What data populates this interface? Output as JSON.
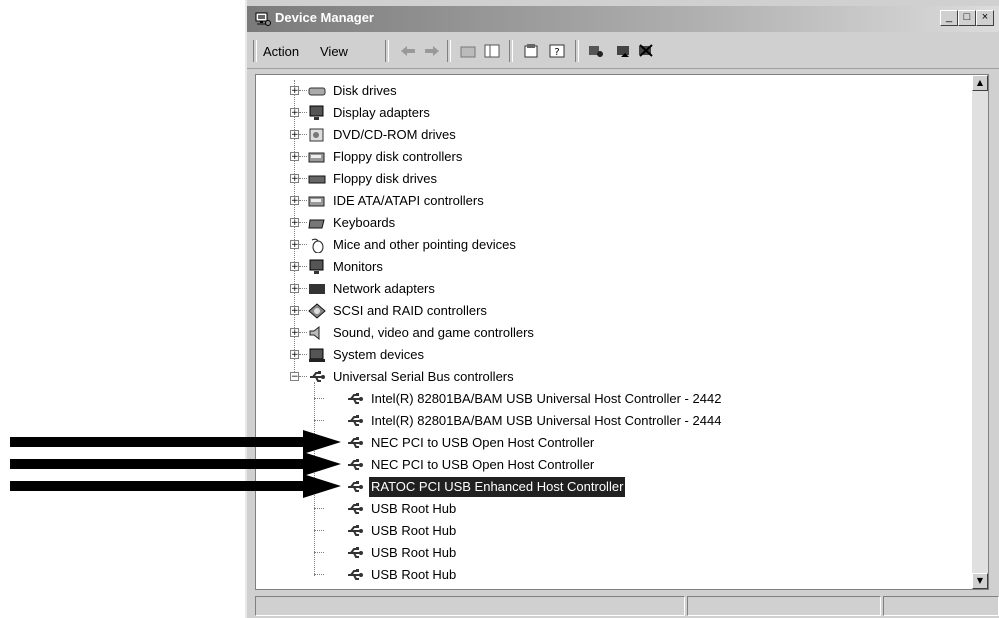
{
  "window": {
    "title": "Device Manager"
  },
  "toolbar": {
    "menu": [
      "Action",
      "View"
    ]
  },
  "tree": {
    "categories": [
      {
        "label": "Disk drives",
        "icon": "disk-drive-icon"
      },
      {
        "label": "Display adapters",
        "icon": "monitor-icon"
      },
      {
        "label": "DVD/CD-ROM drives",
        "icon": "cdrom-icon"
      },
      {
        "label": "Floppy disk controllers",
        "icon": "controller-icon"
      },
      {
        "label": "Floppy disk drives",
        "icon": "floppy-drive-icon"
      },
      {
        "label": "IDE ATA/ATAPI controllers",
        "icon": "controller-icon"
      },
      {
        "label": "Keyboards",
        "icon": "keyboard-icon"
      },
      {
        "label": "Mice and other pointing devices",
        "icon": "mouse-icon"
      },
      {
        "label": "Monitors",
        "icon": "monitor-icon"
      },
      {
        "label": "Network adapters",
        "icon": "network-adapter-icon"
      },
      {
        "label": "SCSI and RAID controllers",
        "icon": "scsi-icon"
      },
      {
        "label": "Sound, video and game controllers",
        "icon": "sound-icon"
      },
      {
        "label": "System devices",
        "icon": "system-icon"
      },
      {
        "label": "Universal Serial Bus controllers",
        "icon": "usb-icon",
        "expanded": true
      }
    ],
    "usb_children": [
      {
        "label": "Intel(R) 82801BA/BAM USB Universal Host Controller - 2442"
      },
      {
        "label": "Intel(R) 82801BA/BAM USB Universal Host Controller - 2444"
      },
      {
        "label": "NEC PCI to USB Open Host Controller"
      },
      {
        "label": "NEC PCI to USB Open Host Controller"
      },
      {
        "label": "RATOC PCI USB Enhanced Host Controller",
        "selected": true
      },
      {
        "label": "USB Root Hub"
      },
      {
        "label": "USB Root Hub"
      },
      {
        "label": "USB Root Hub"
      },
      {
        "label": "USB Root Hub"
      }
    ]
  },
  "annotations": {
    "arrow_targets": [
      "NEC PCI to USB Open Host Controller",
      "NEC PCI to USB Open Host Controller",
      "RATOC PCI USB Enhanced Host Controller"
    ]
  },
  "colors": {
    "selection": "#202020",
    "arrow": "#000000"
  }
}
